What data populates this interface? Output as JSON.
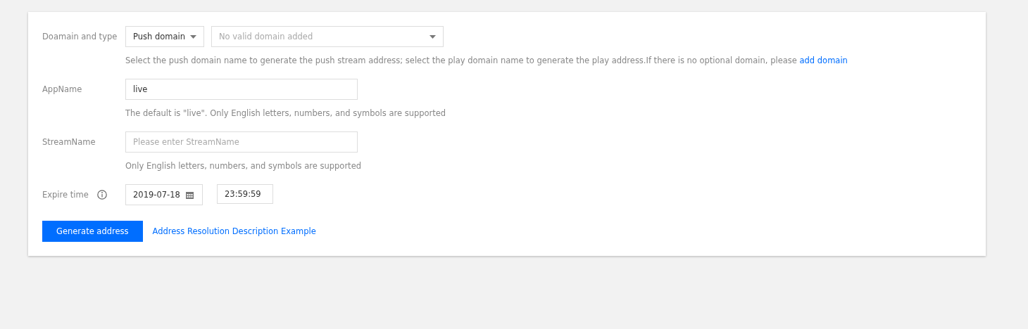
{
  "domain": {
    "label": "Doamain and type",
    "type_select": "Push domain",
    "domain_select": {
      "placeholder": "No valid domain added"
    },
    "hint": "Select the push domain name to generate the push stream address; select the play domain name to generate the play address.If there is no optional domain, please ",
    "hint_link": "add domain"
  },
  "app_name": {
    "label": "AppName",
    "value": "live",
    "hint": "The default is \"live\". Only English letters, numbers, and symbols are supported"
  },
  "stream_name": {
    "label": "StreamName",
    "placeholder": "Please enter StreamName",
    "hint": "Only English letters, numbers, and symbols are supported"
  },
  "expire": {
    "label": "Expire time",
    "date": "2019-07-18",
    "time": "23:59:59"
  },
  "actions": {
    "primary": "Generate address",
    "link": "Address Resolution Description Example"
  }
}
